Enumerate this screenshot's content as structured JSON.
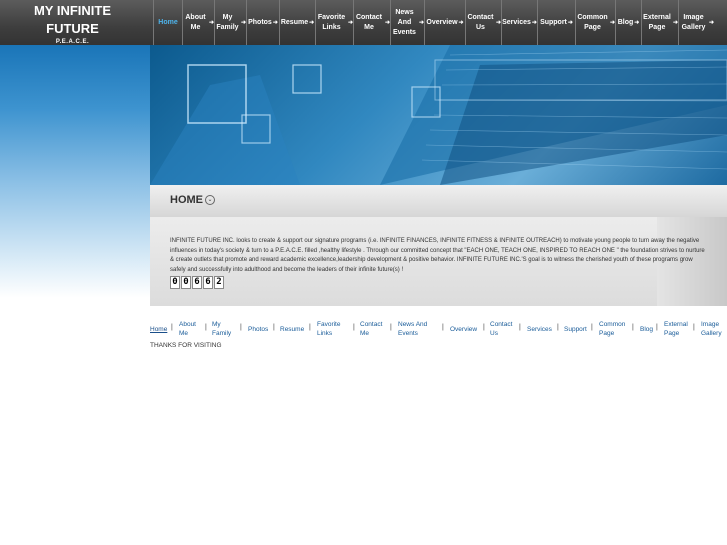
{
  "logo": {
    "line1": "MY INFINITE",
    "line2": "FUTURE",
    "line3": "P.E.A.C.E."
  },
  "nav": [
    {
      "label": "Home"
    },
    {
      "label": "About Me"
    },
    {
      "label": "My Family"
    },
    {
      "label": "Photos"
    },
    {
      "label": "Resume"
    },
    {
      "label": "Favorite Links"
    },
    {
      "label": "Contact Me"
    },
    {
      "label": "News And Events"
    },
    {
      "label": "Overview"
    },
    {
      "label": "Contact Us"
    },
    {
      "label": "Services"
    },
    {
      "label": "Support"
    },
    {
      "label": "Common Page"
    },
    {
      "label": "Blog"
    },
    {
      "label": "External Page"
    },
    {
      "label": "Image Gallery"
    }
  ],
  "page": {
    "title": "HOME"
  },
  "intro": "INFINITE FUTURE INC. looks to create & support our signature programs (i.e. INFINITE FINANCES, INFINITE FITNESS & INFINITE OUTREACH) to motivate young people to turn away the negative influences in today's society & turn to a P.E.A.C.E. filled ,healthy lifestyle . Through our committed concept that \"EACH ONE, TEACH ONE, INSPIRED TO REACH ONE \" the foundation strives to nurture & create outlets that promote and reward academic excellence,leadership development & positive behavior. INFINITE FUTURE INC.'S goal is to witness the cherished youth of these programs grow safely and successfully into adulthood and become the leaders of their infinite future(s) !",
  "counter": [
    "0",
    "0",
    "6",
    "6",
    "2"
  ],
  "footer": {
    "thanks": "THANKS FOR VISITING"
  },
  "colors": {
    "header": "#3e3e3e",
    "active_nav": "#4db3ea",
    "link": "#1a5c99"
  }
}
